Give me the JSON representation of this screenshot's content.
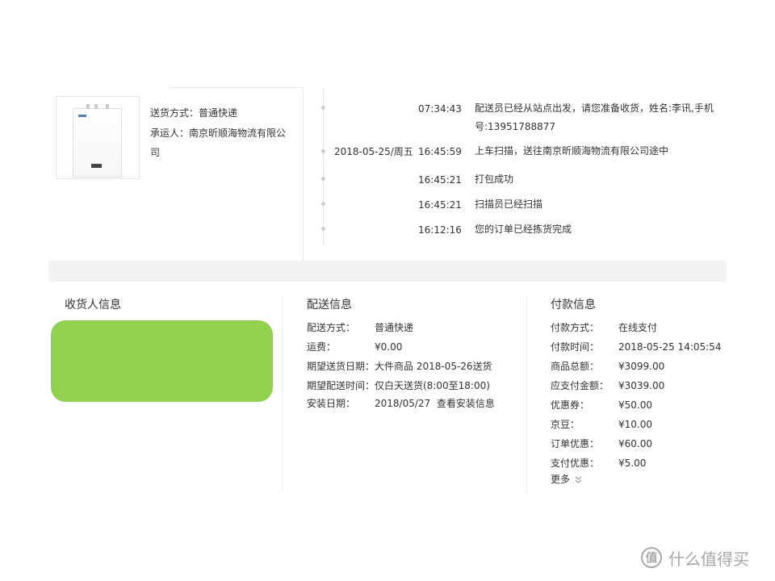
{
  "shipment": {
    "method_label": "送货方式：",
    "method_value": "普通快递",
    "carrier_label": "承运人：",
    "carrier_value": "南京昕顺海物流有限公司"
  },
  "tracking": [
    {
      "date": "",
      "time": "07:34:43",
      "text": "配送员已经从站点出发，请您准备收货，姓名:李讯,手机号:13951788877"
    },
    {
      "date": "2018-05-25/周五",
      "time": "16:45:59",
      "text": "上车扫描，送往南京昕顺海物流有限公司途中"
    },
    {
      "date": "",
      "time": "16:45:21",
      "text": "打包成功"
    },
    {
      "date": "",
      "time": "16:45:21",
      "text": "扫描员已经扫描"
    },
    {
      "date": "",
      "time": "16:12:16",
      "text": "您的订单已经拣货完成"
    }
  ],
  "consignee": {
    "title": "收货人信息",
    "redaction_color": "#92d050"
  },
  "delivery": {
    "title": "配送信息",
    "rows": [
      {
        "label": "配送方式：",
        "value": "普通快递"
      },
      {
        "label": "运费：",
        "value": "¥0.00"
      },
      {
        "label": "期望送货日期：",
        "value": "大件商品  2018-05-26送货"
      },
      {
        "label": "期望配送时间：",
        "value": "仅白天送货(8:00至18:00)"
      },
      {
        "label": "安装日期：",
        "value": "2018/05/27",
        "link": "查看安装信息"
      }
    ]
  },
  "payment": {
    "title": "付款信息",
    "rows": [
      {
        "label": "付款方式：",
        "value": "在线支付"
      },
      {
        "label": "付款时间：",
        "value": "2018-05-25 14:05:54"
      },
      {
        "label": "商品总额：",
        "value": "¥3099.00"
      },
      {
        "label": "应支付金额：",
        "value": "¥3039.00"
      },
      {
        "label": "优惠券：",
        "value": "¥50.00"
      },
      {
        "label": "京豆：",
        "value": "¥10.00"
      },
      {
        "label": "订单优惠：",
        "value": "¥60.00"
      },
      {
        "label": "支付优惠：",
        "value": "¥5.00"
      }
    ],
    "more_label": "更多"
  },
  "watermark": {
    "badge": "值",
    "text": "什么值得买"
  }
}
